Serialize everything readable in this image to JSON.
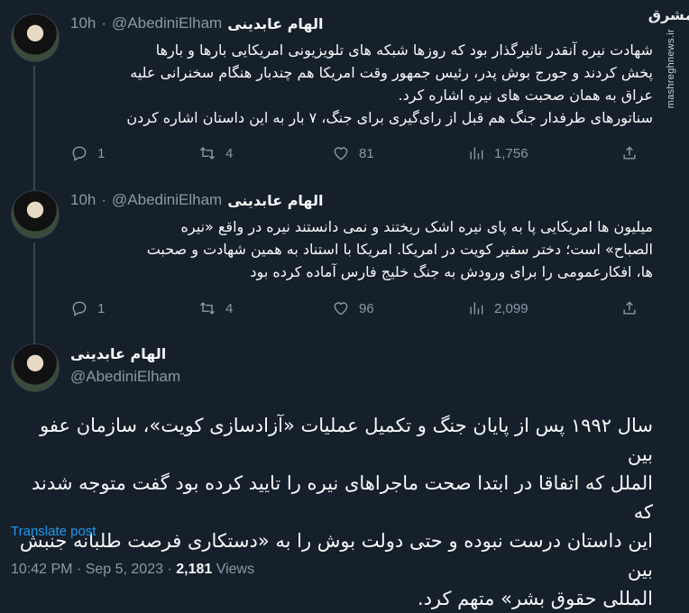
{
  "watermark": {
    "logo": "مشرق",
    "site": "mashreghnews.ir"
  },
  "author": {
    "name": "الهام عابدینی",
    "handle": "@AbediniElham"
  },
  "tweets": [
    {
      "time": "10h",
      "lines": [
        "شهادت نیره آنقدر تاثیرگذار بود که روزها شبکه های تلویزیونی امریکایی بارها و بارها",
        "پخش کردند و جورج بوش پدر، رئیس جمهور وقت امریکا هم چندبار هنگام سخنرانی علیه",
        "عراق به همان صحبت های نیره اشاره کرد.",
        "سناتورهای طرفدار جنگ هم قبل از رای‌گیری برای جنگ، ۷ بار به این داستان اشاره کردن"
      ],
      "replies": "1",
      "reposts": "4",
      "likes": "81",
      "views": "1,756"
    },
    {
      "time": "10h",
      "lines": [
        "میلیون ها امریکایی پا به پای نیره اشک ریختند و نمی دانستند نیره در واقع «نیره",
        "الصباح» است؛ دختر سفیر کویت در امریکا. امریکا با استناد به همین شهادت و صحبت",
        "ها، افکارعمومی را برای ورودش به جنگ خلیج فارس آماده کرده بود"
      ],
      "replies": "1",
      "reposts": "4",
      "likes": "96",
      "views": "2,099"
    }
  ],
  "main_tweet": {
    "lines": [
      "سال ۱۹۹۲ پس از پایان جنگ و تکمیل عملیات «آزادسازی کویت»، سازمان عفو بین",
      "الملل که اتفاقا در ابتدا صحت ماجراهای نیره را تایید کرده بود گفت متوجه شدند که",
      "این داستان درست نبوده و حتی دولت بوش را به «دستکاری فرصت طلبانه جنبش بین",
      "المللی حقوق بشر» متهم کرد."
    ],
    "translate": "Translate post",
    "timestamp": "10:42 PM · Sep 5, 2023 · ",
    "views_count": "2,181",
    "views_label": " Views"
  }
}
